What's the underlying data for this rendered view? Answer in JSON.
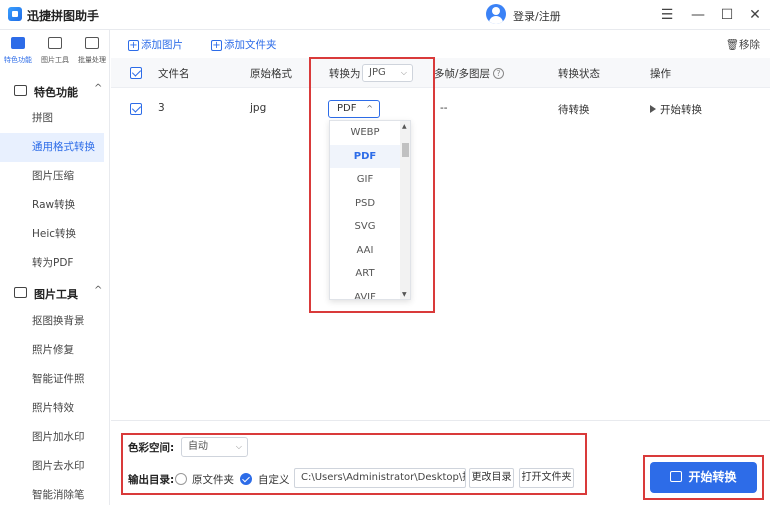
{
  "app": {
    "title": "迅捷拼图助手",
    "login": "登录/注册"
  },
  "window": {
    "menu": "☰",
    "minimize": "—",
    "maximize": "☐",
    "close": "✕"
  },
  "rail": {
    "tabs": [
      {
        "label": "特色功能",
        "icon": "grid-icon",
        "active": true
      },
      {
        "label": "图片工具",
        "icon": "image-tool-icon",
        "active": false
      },
      {
        "label": "批量处理",
        "icon": "batch-icon",
        "active": false
      }
    ]
  },
  "sidebar": {
    "sections": [
      {
        "title": "特色功能",
        "chevron": "^",
        "items": [
          {
            "label": "拼图"
          },
          {
            "label": "通用格式转换",
            "active": true
          },
          {
            "label": "图片压缩"
          },
          {
            "label": "Raw转换"
          },
          {
            "label": "Heic转换"
          },
          {
            "label": "转为PDF"
          }
        ]
      },
      {
        "title": "图片工具",
        "chevron": "^",
        "items": [
          {
            "label": "抠图换背景"
          },
          {
            "label": "照片修复"
          },
          {
            "label": "智能证件照"
          },
          {
            "label": "照片特效"
          },
          {
            "label": "图片加水印"
          },
          {
            "label": "图片去水印"
          },
          {
            "label": "智能消除笔"
          }
        ]
      }
    ]
  },
  "toolbar": {
    "add_image": "添加图片",
    "add_folder": "添加文件夹",
    "remove": "移除"
  },
  "table": {
    "headers": {
      "filename": "文件名",
      "original_format": "原始格式",
      "convert_to": "转换为",
      "convert_to_value": "JPG",
      "multiframe": "多帧/多图层",
      "status": "转换状态",
      "action": "操作"
    },
    "rows": [
      {
        "filename": "3",
        "format": "jpg",
        "target": "PDF",
        "multiframe": "--",
        "status": "待转换",
        "action": "开始转换"
      }
    ]
  },
  "dropdown": {
    "options": [
      "WEBP",
      "PDF",
      "GIF",
      "PSD",
      "SVG",
      "AAI",
      "ART",
      "AVIF"
    ],
    "selected": "PDF"
  },
  "bottom": {
    "color_space_label": "色彩空间:",
    "color_space_value": "自动",
    "output_label": "输出目录:",
    "option_original": "原文件夹",
    "option_custom": "自定义",
    "path": "C:\\Users\\Administrator\\Desktop\\拼图",
    "change_dir": "更改目录",
    "open_folder": "打开文件夹",
    "start": "开始转换"
  },
  "colors": {
    "accent": "#2d6ce8",
    "highlight_box": "#d93a3a",
    "active_bg": "#e8f0fe"
  }
}
